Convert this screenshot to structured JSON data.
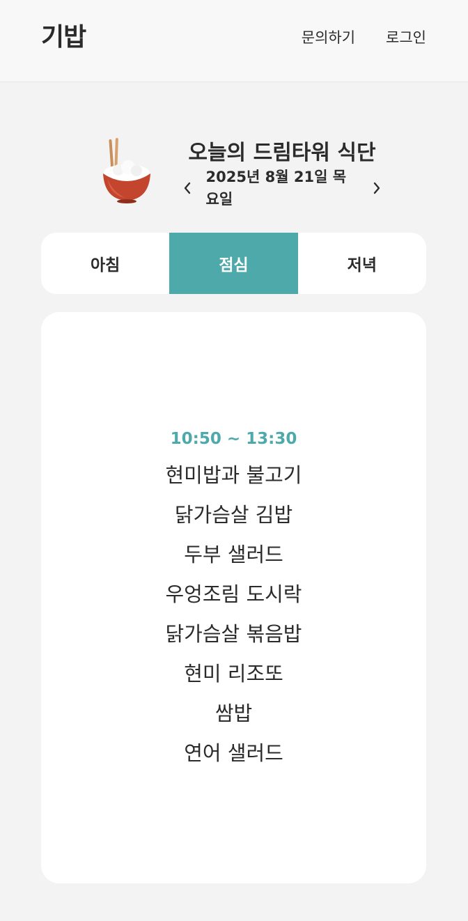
{
  "header": {
    "logo": "기밥",
    "nav": [
      "문의하기",
      "로그인"
    ]
  },
  "hero": {
    "icon": "rice-bowl-icon",
    "title": "오늘의 드림타워 식단",
    "date": "2025년 8월 21일 목요일"
  },
  "tabs": [
    {
      "label": "아침",
      "active": false
    },
    {
      "label": "점심",
      "active": true
    },
    {
      "label": "저녁",
      "active": false
    }
  ],
  "meal": {
    "time": "10:50 ~ 13:30",
    "items": [
      "현미밥과 불고기",
      "닭가슴살 김밥",
      "두부 샐러드",
      "우엉조림 도시락",
      "닭가슴살 볶음밥",
      "현미 리조또",
      "쌈밥",
      "연어 샐러드"
    ]
  },
  "colors": {
    "accent": "#4ea9ab",
    "background": "#f3f3f3",
    "text": "#2b2b2b"
  }
}
